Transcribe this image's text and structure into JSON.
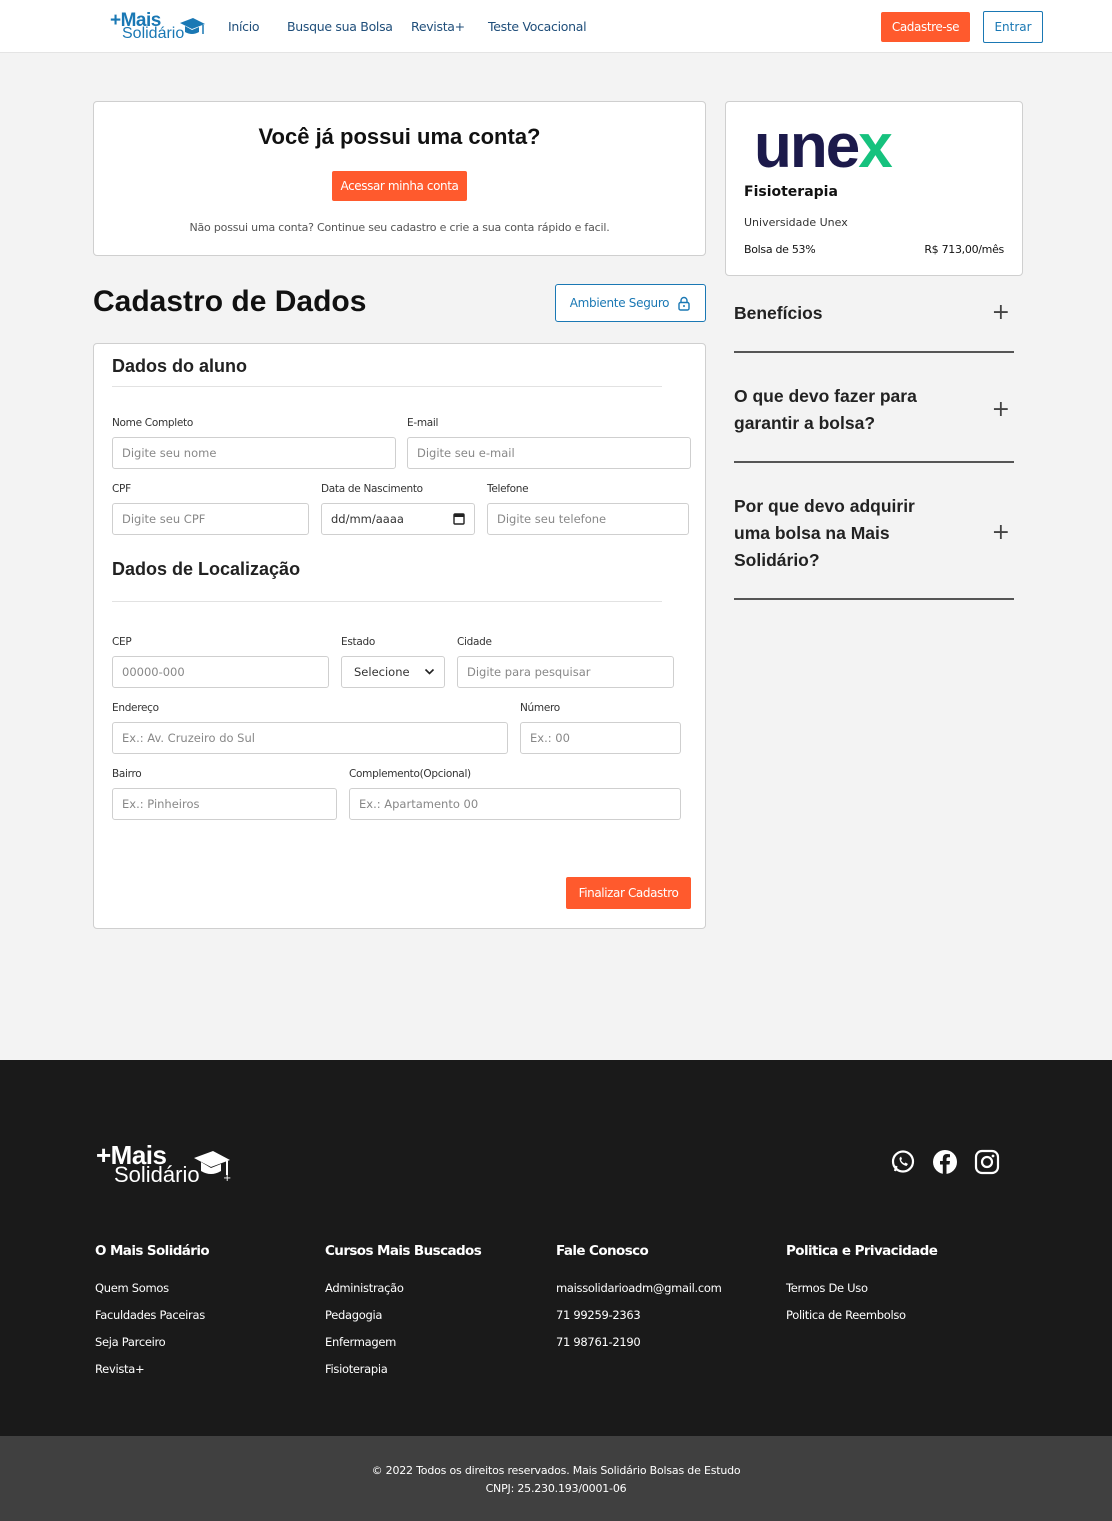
{
  "nav": {
    "logo_top": "+Mais",
    "logo_bottom": "Solidário",
    "links": [
      "Início",
      "Busque sua Bolsa",
      "Revista+",
      "Teste Vocacional"
    ],
    "signup": "Cadastre-se",
    "login": "Entrar"
  },
  "account": {
    "title": "Você já possui uma conta?",
    "button": "Acessar minha conta",
    "note": "Não possui uma conta? Continue seu cadastro e crie a sua conta rápido e facil."
  },
  "page_title": "Cadastro de Dados",
  "secure_label": "Ambiente Seguro",
  "form": {
    "student_title": "Dados do aluno",
    "location_title": "Dados de Localização",
    "fields": {
      "name": {
        "label": "Nome Completo",
        "placeholder": "Digite seu nome"
      },
      "email": {
        "label": "E-mail",
        "placeholder": "Digite seu e-mail"
      },
      "cpf": {
        "label": "CPF",
        "placeholder": "Digite seu CPF"
      },
      "birth": {
        "label": "Data de Nascimento",
        "placeholder": "dd/mm/aaaa"
      },
      "phone": {
        "label": "Telefone",
        "placeholder": "Digite seu telefone"
      },
      "cep": {
        "label": "CEP",
        "placeholder": "00000-000"
      },
      "state": {
        "label": "Estado",
        "value": "Selecione"
      },
      "city": {
        "label": "Cidade",
        "placeholder": "Digite para pesquisar"
      },
      "address": {
        "label": "Endereço",
        "placeholder": "Ex.: Av. Cruzeiro do Sul"
      },
      "number": {
        "label": "Número",
        "placeholder": "Ex.: 00"
      },
      "district": {
        "label": "Bairro",
        "placeholder": "Ex.: Pinheiros"
      },
      "complement": {
        "label": "Complemento(Opcional)",
        "placeholder": "Ex.: Apartamento 00"
      }
    },
    "submit": "Finalizar Cadastro"
  },
  "course_card": {
    "brand_main": "une",
    "brand_x": "x",
    "course": "Fisioterapia",
    "university": "Universidade Unex",
    "scholarship": "Bolsa de 53%",
    "price": "R$ 713,00/mês",
    "brand_color": "#1c1a4b",
    "brand_accent": "#16c27e"
  },
  "faq": [
    {
      "question": "Benefícios"
    },
    {
      "question": "O que devo fazer para garantir a bolsa?"
    },
    {
      "question": "Por que devo adquirir uma bolsa na Mais Solidário?"
    }
  ],
  "footer": {
    "logo_top": "+Mais",
    "logo_bottom": "Solidário",
    "social": [
      "whatsapp-icon",
      "facebook-icon",
      "instagram-icon"
    ],
    "columns": [
      {
        "title": "O Mais Solidário",
        "items": [
          "Quem Somos",
          "Faculdades Paceiras",
          "Seja Parceiro",
          "Revista+"
        ]
      },
      {
        "title": "Cursos Mais Buscados",
        "items": [
          "Administração",
          "Pedagogia",
          "Enfermagem",
          "Fisioterapia"
        ]
      },
      {
        "title": "Fale Conosco",
        "items": [
          "maissolidarioadm@gmail.com",
          "71 99259-2363",
          "71 98761-2190"
        ]
      },
      {
        "title": "Politica e Privacidade",
        "items": [
          "Termos De Uso",
          "Politica de Reembolso"
        ]
      }
    ],
    "copyright": "© 2022 Todos os direitos reservados. Mais Solidário Bolsas de Estudo",
    "cnpj": "CNPJ: 25.230.193/0001-06"
  },
  "colors": {
    "accent": "#ff5a2d",
    "brand": "#1a78b4",
    "footer_bg": "#1a1a1a"
  }
}
